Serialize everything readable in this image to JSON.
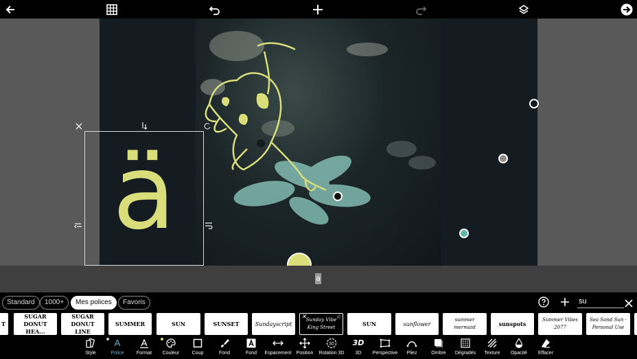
{
  "topbar": {
    "icons": [
      "back-arrow-icon",
      "grid-icon",
      "undo-icon",
      "add-icon",
      "redo-icon",
      "layers-icon",
      "next-arrow-icon"
    ]
  },
  "canvas": {
    "text_layer": {
      "character": "ä",
      "color": "#d9dd7a"
    },
    "handle_colors": {
      "white": "#ffffff",
      "gray": "#8c8c8c",
      "teal": "#5fb8a8",
      "yellow": "#d9dd7a",
      "black": "#111111"
    }
  },
  "strip": {
    "preview_char": "a"
  },
  "tabs": [
    {
      "label": "Standard",
      "active": false
    },
    {
      "label": "1000+",
      "active": false
    },
    {
      "label": "Mes polices",
      "active": true
    },
    {
      "label": "Favoris",
      "active": false
    }
  ],
  "search": {
    "value": "su"
  },
  "fonts": [
    "SUGAR DONUT HEA...",
    "SUGAR DONUT LINE",
    "SUMMER",
    "SUN",
    "SUNSET",
    "Sundayscript",
    "Sunday Vibe King Street",
    "SUN",
    "sunflower",
    "summer mermaid",
    "sunspots",
    "Summer Vibes 2077",
    "Sea Sand Sun · Personal Use"
  ],
  "tools": [
    {
      "label": "Style",
      "icon": "style-icon"
    },
    {
      "label": "Police",
      "icon": "font-icon",
      "active": true
    },
    {
      "label": "Format",
      "icon": "format-icon"
    },
    {
      "label": "Couleur",
      "icon": "palette-icon"
    },
    {
      "label": "Coup",
      "icon": "stroke-icon"
    },
    {
      "label": "Fond",
      "icon": "brush-icon"
    },
    {
      "label": "Fond",
      "icon": "text-background-icon"
    },
    {
      "label": "Espacement",
      "icon": "spacing-icon"
    },
    {
      "label": "Position",
      "icon": "move-icon"
    },
    {
      "label": "Rotation 3D",
      "icon": "rotation-3d-icon"
    },
    {
      "label": "3D",
      "icon": "3d-icon"
    },
    {
      "label": "Perspective",
      "icon": "perspective-icon"
    },
    {
      "label": "Pliez",
      "icon": "bend-icon"
    },
    {
      "label": "Ombre",
      "icon": "shadow-icon"
    },
    {
      "label": "Dégradés",
      "icon": "gradient-icon"
    },
    {
      "label": "Texture",
      "icon": "texture-icon"
    },
    {
      "label": "Opacité",
      "icon": "opacity-icon"
    },
    {
      "label": "Effacer",
      "icon": "eraser-icon"
    }
  ],
  "text_3d": "3D"
}
